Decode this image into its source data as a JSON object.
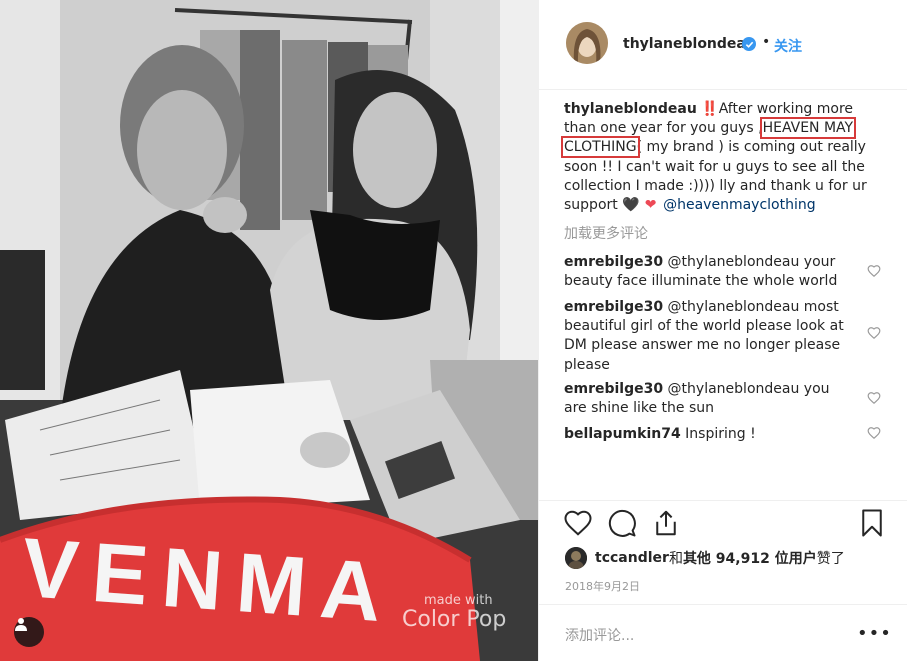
{
  "post": {
    "watermark_line1": "made with",
    "watermark_line2": "Color Pop",
    "sweater_text": "VENMA"
  },
  "header": {
    "username": "thylaneblondeau",
    "separator": "•",
    "follow_label": "关注"
  },
  "caption": {
    "username": "thylaneblondeau",
    "text_1": " ‼️After working more than one year for you guys ,",
    "highlight_1": "HEAVEN MAY",
    "text_2": " ",
    "highlight_2": "CLOTHING",
    "text_3": "( my brand ) is coming out really soon !! I can't wait for u guys to see all the collection I made :)))) lly and thank u for ur support ",
    "heart_black": "🖤",
    "heart_red": "❤",
    "mention": "@heavenmayclothing"
  },
  "load_more": "加载更多评论",
  "comments": [
    {
      "user": "emrebilge30",
      "text": " @thylaneblondeau your beauty face illuminate the whole world"
    },
    {
      "user": "emrebilge30",
      "text": " @thylaneblondeau most beautiful girl of the world please look at DM please answer me no longer please please"
    },
    {
      "user": "emrebilge30",
      "text": " @thylaneblondeau you are shine like the sun"
    },
    {
      "user": "bellapumkin74",
      "text": " Inspiring !"
    }
  ],
  "likes": {
    "user": "tccandler",
    "and": " 和 ",
    "others": "其他 94,912 位用户",
    "suffix": " 赞了"
  },
  "date": "2018年9月2日",
  "add_comment_placeholder": "添加评论...",
  "more_icon": "•••",
  "colors": {
    "accent": "#3897f0",
    "highlight_box": "#d63a3a",
    "heart_red": "#ed4956"
  }
}
